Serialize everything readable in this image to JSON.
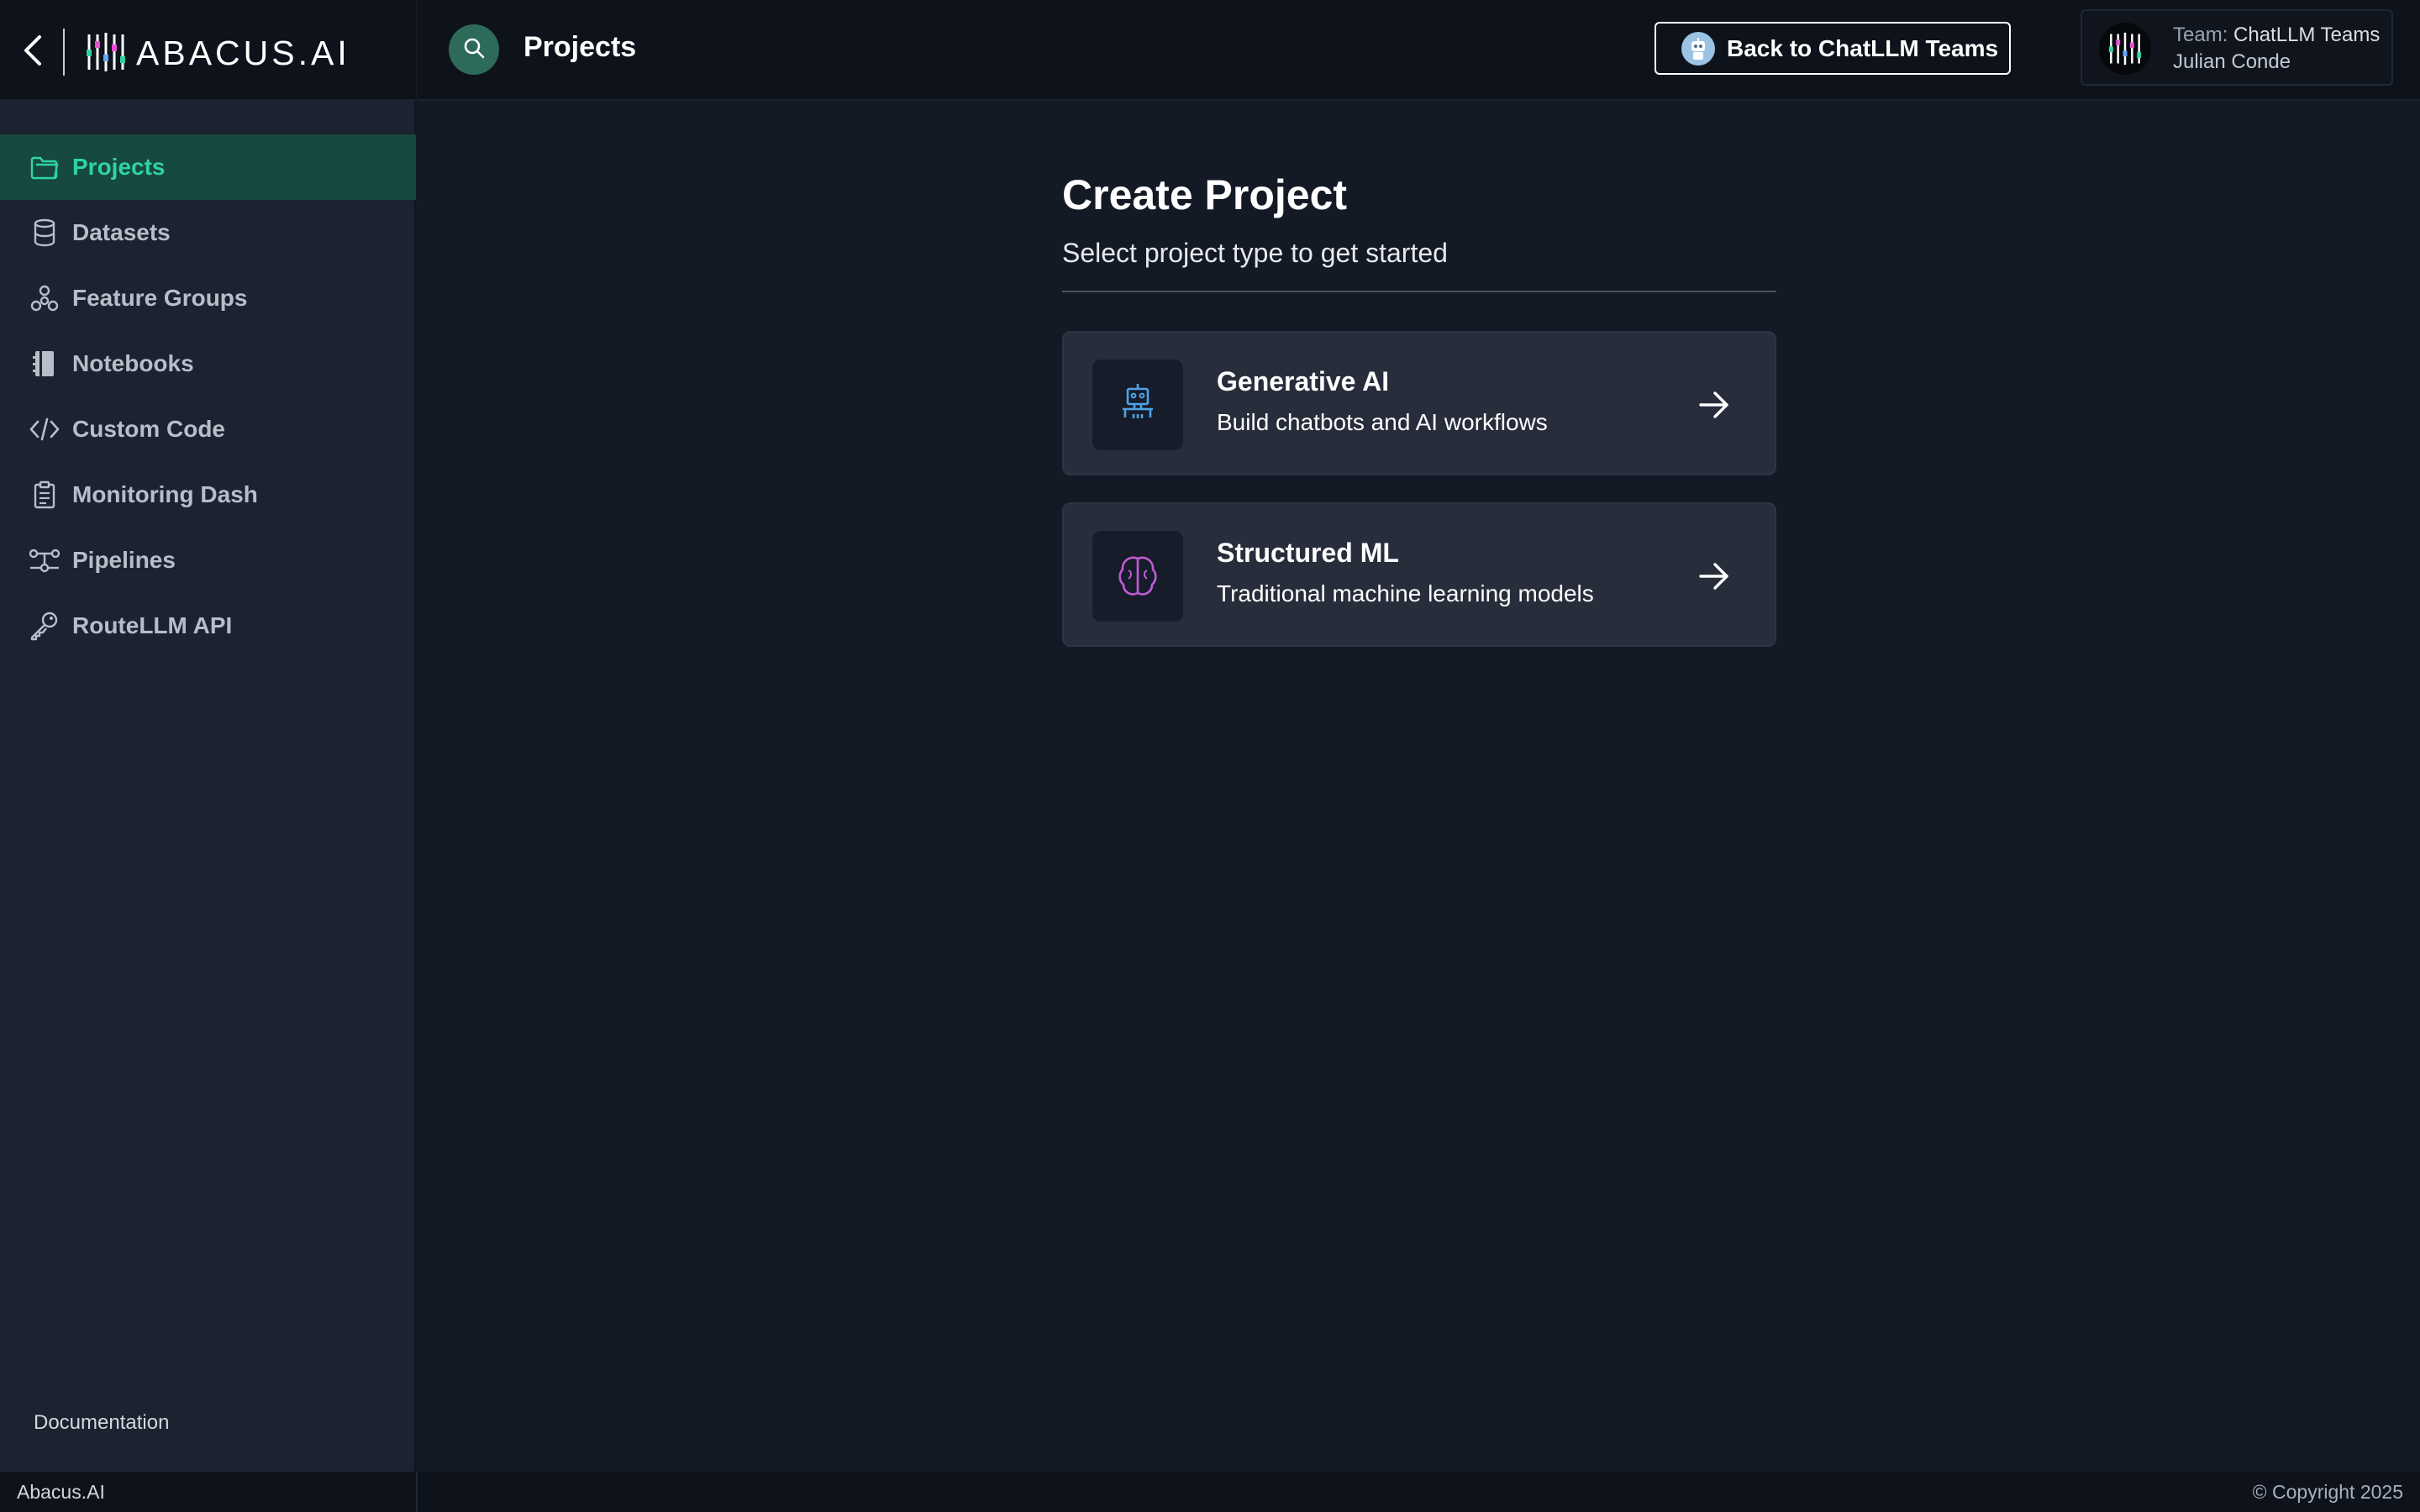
{
  "app": {
    "logo_text": "ABACUS.AI"
  },
  "sidebar": {
    "items": [
      {
        "label": "Projects",
        "icon": "folder-icon",
        "active": true
      },
      {
        "label": "Datasets",
        "icon": "database-icon",
        "active": false
      },
      {
        "label": "Feature Groups",
        "icon": "feature-groups-icon",
        "active": false
      },
      {
        "label": "Notebooks",
        "icon": "notebook-icon",
        "active": false
      },
      {
        "label": "Custom Code",
        "icon": "code-icon",
        "active": false
      },
      {
        "label": "Monitoring Dash",
        "icon": "clipboard-icon",
        "active": false
      },
      {
        "label": "Pipelines",
        "icon": "pipeline-icon",
        "active": false
      },
      {
        "label": "RouteLLM API",
        "icon": "key-icon",
        "active": false
      }
    ],
    "documentation_label": "Documentation"
  },
  "header": {
    "title": "Projects",
    "back_button_label": "Back to ChatLLM Teams",
    "team_prefix": "Team: ",
    "team_name": "ChatLLM Teams",
    "user_name": "Julian Conde"
  },
  "main": {
    "title": "Create Project",
    "subtitle": "Select project type to get started",
    "cards": [
      {
        "title": "Generative AI",
        "description": "Build chatbots and AI workflows",
        "icon": "robot-icon"
      },
      {
        "title": "Structured ML",
        "description": "Traditional machine learning models",
        "icon": "brain-icon"
      }
    ]
  },
  "footer": {
    "left": "Abacus.AI",
    "right": "© Copyright 2025"
  },
  "colors": {
    "accent": "#2fd3a6",
    "active_bg": "#16493f",
    "sidebar_bg": "#1b2230",
    "main_bg": "#141a25",
    "card_bg": "#272d3b",
    "robot_icon": "#4ea3e8",
    "brain_icon": "#c45ad6"
  }
}
